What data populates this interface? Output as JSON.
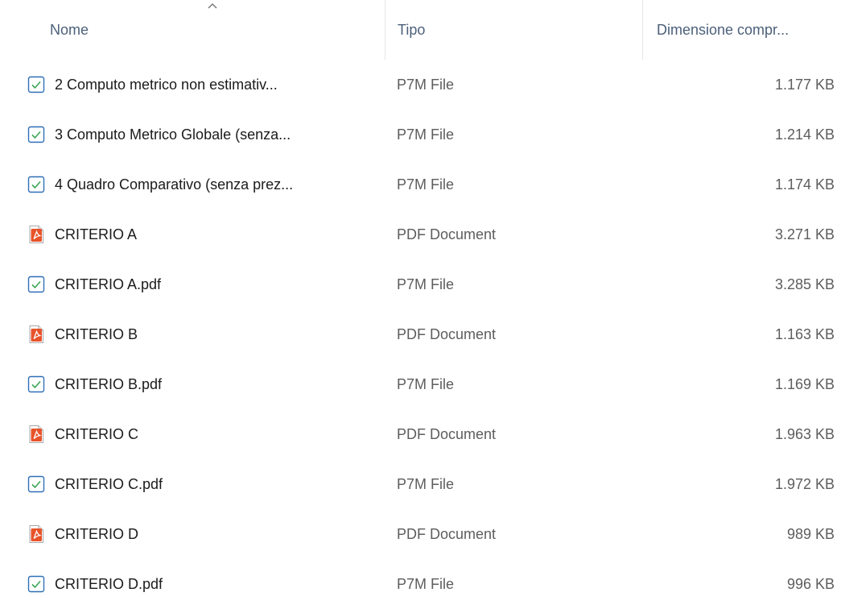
{
  "columns": {
    "name": "Nome",
    "type": "Tipo",
    "size": "Dimensione compr..."
  },
  "files": [
    {
      "name": "2 Computo metrico non estimativ...",
      "type": "P7M File",
      "size": "1.177 KB",
      "icon": "p7m-signed-icon"
    },
    {
      "name": "3 Computo Metrico Globale (senza...",
      "type": "P7M File",
      "size": "1.214 KB",
      "icon": "p7m-signed-icon"
    },
    {
      "name": "4 Quadro Comparativo (senza prez...",
      "type": "P7M File",
      "size": "1.174 KB",
      "icon": "p7m-signed-icon"
    },
    {
      "name": "CRITERIO A",
      "type": "PDF Document",
      "size": "3.271 KB",
      "icon": "pdf-icon"
    },
    {
      "name": "CRITERIO A.pdf",
      "type": "P7M File",
      "size": "3.285 KB",
      "icon": "p7m-signed-icon"
    },
    {
      "name": "CRITERIO B",
      "type": "PDF Document",
      "size": "1.163 KB",
      "icon": "pdf-icon"
    },
    {
      "name": "CRITERIO B.pdf",
      "type": "P7M File",
      "size": "1.169 KB",
      "icon": "p7m-signed-icon"
    },
    {
      "name": "CRITERIO C",
      "type": "PDF Document",
      "size": "1.963 KB",
      "icon": "pdf-icon"
    },
    {
      "name": "CRITERIO C.pdf",
      "type": "P7M File",
      "size": "1.972 KB",
      "icon": "p7m-signed-icon"
    },
    {
      "name": "CRITERIO D",
      "type": "PDF Document",
      "size": "989 KB",
      "icon": "pdf-icon"
    },
    {
      "name": "CRITERIO D.pdf",
      "type": "P7M File",
      "size": "996 KB",
      "icon": "p7m-signed-icon"
    }
  ],
  "colors": {
    "header_text": "#4c607a",
    "p7m_icon_stroke": "#2f6fb8",
    "p7m_check": "#3aa655",
    "pdf_icon_body": "#e8532b"
  }
}
